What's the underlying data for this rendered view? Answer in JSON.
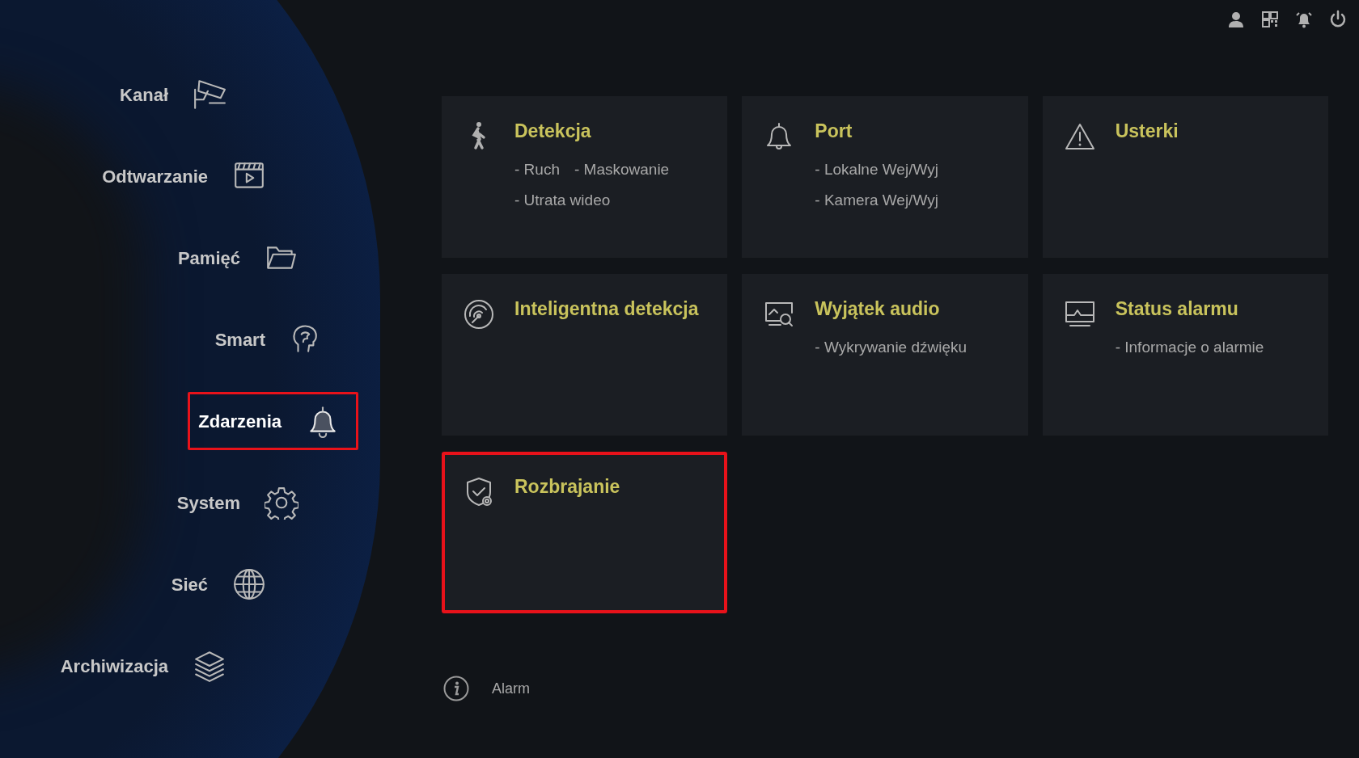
{
  "sidebar": {
    "items": [
      {
        "label": "Kanał",
        "selected": false
      },
      {
        "label": "Odtwarzanie",
        "selected": false
      },
      {
        "label": "Pamięć",
        "selected": false
      },
      {
        "label": "Smart",
        "selected": false
      },
      {
        "label": "Zdarzenia",
        "selected": true
      },
      {
        "label": "System",
        "selected": false
      },
      {
        "label": "Sieć",
        "selected": false
      },
      {
        "label": "Archiwizacja",
        "selected": false
      }
    ]
  },
  "cards": [
    {
      "title": "Detekcja",
      "items": [
        "- Ruch",
        "- Maskowanie",
        "- Utrata wideo"
      ],
      "selected": false
    },
    {
      "title": "Port",
      "items": [
        "- Lokalne Wej/Wyj",
        "- Kamera Wej/Wyj"
      ],
      "selected": false
    },
    {
      "title": "Usterki",
      "selected": false
    },
    {
      "title": "Inteligentna detekcja",
      "selected": false
    },
    {
      "title": "Wyjątek audio",
      "items": [
        "- Wykrywanie dźwięku"
      ],
      "selected": false
    },
    {
      "title": "Status alarmu",
      "items": [
        "- Informacje o alarmie"
      ],
      "selected": false
    },
    {
      "title": "Rozbrajanie",
      "selected": true
    }
  ],
  "footer": {
    "label": "Alarm"
  }
}
